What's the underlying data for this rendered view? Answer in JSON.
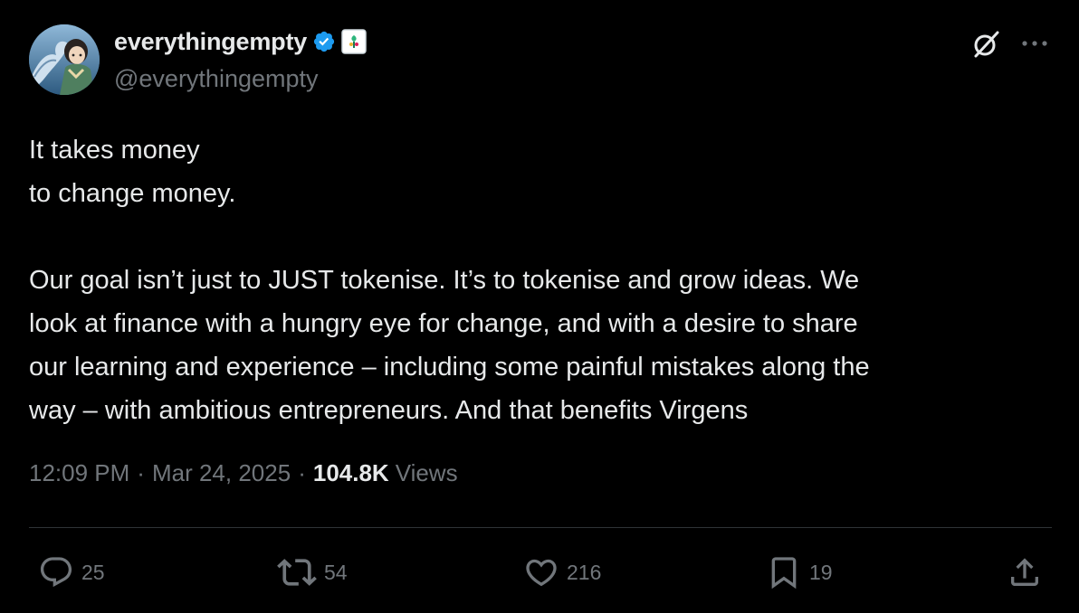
{
  "author": {
    "display_name": "everythingempty",
    "handle": "@everythingempty",
    "verified": true,
    "verified_color": "#1d9bf0"
  },
  "tweet": {
    "lines_block1": [
      "It takes money",
      "to change money."
    ],
    "lines_block2": [
      "Our goal isn’t just to JUST tokenise. It’s to tokenise and grow ideas. We",
      "look at finance with a hungry eye for change, and with a desire to share",
      "our learning and experience – including some painful mistakes along the",
      "way – with ambitious entrepreneurs. And that benefits Virgens"
    ]
  },
  "meta": {
    "time": "12:09 PM",
    "separator": "·",
    "date": "Mar 24, 2025",
    "views_count": "104.8K",
    "views_label": "Views"
  },
  "actions": {
    "replies": "25",
    "reposts": "54",
    "likes": "216",
    "bookmarks": "19"
  },
  "icons": {
    "header": [
      "grok-icon",
      "more-icon"
    ],
    "actions": [
      "reply-icon",
      "repost-icon",
      "like-icon",
      "bookmark-icon",
      "share-icon"
    ]
  },
  "colors": {
    "background": "#000000",
    "text_primary": "#e7e9ea",
    "text_secondary": "#71767b",
    "divider": "#2f3336"
  }
}
